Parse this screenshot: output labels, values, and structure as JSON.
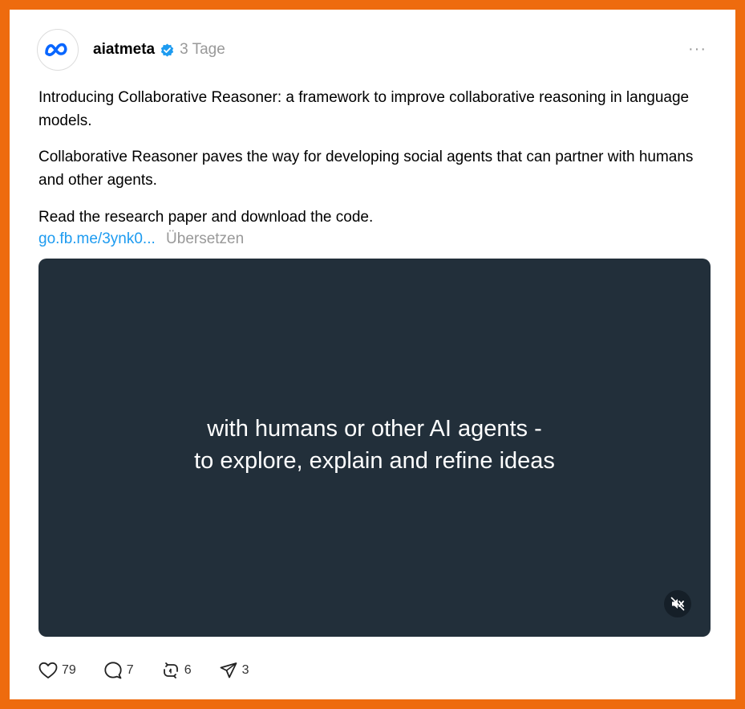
{
  "post": {
    "username": "aiatmeta",
    "time": "3 Tage",
    "more_icon": "more-horizontal-icon",
    "paragraph1": "Introducing Collaborative Reasoner: a framework to improve collaborative reasoning in language models.",
    "paragraph2": "Collaborative Reasoner paves the way for developing social agents that can partner with humans and other agents.",
    "paragraph3": "Read the research paper and download the code.",
    "link": "go.fb.me/3ynk0...",
    "translate": "Übersetzen"
  },
  "video": {
    "caption_line1": "with humans or other AI agents -",
    "caption_line2": "to explore, explain and refine ideas",
    "mute_icon": "speaker-muted-icon"
  },
  "actions": {
    "likes": "79",
    "comments": "7",
    "reposts": "6",
    "shares": "3"
  },
  "colors": {
    "frame": "#ee6b0e",
    "link": "#1d9bf0",
    "video_bg": "#222f3a",
    "verified": "#1d9bf0"
  }
}
